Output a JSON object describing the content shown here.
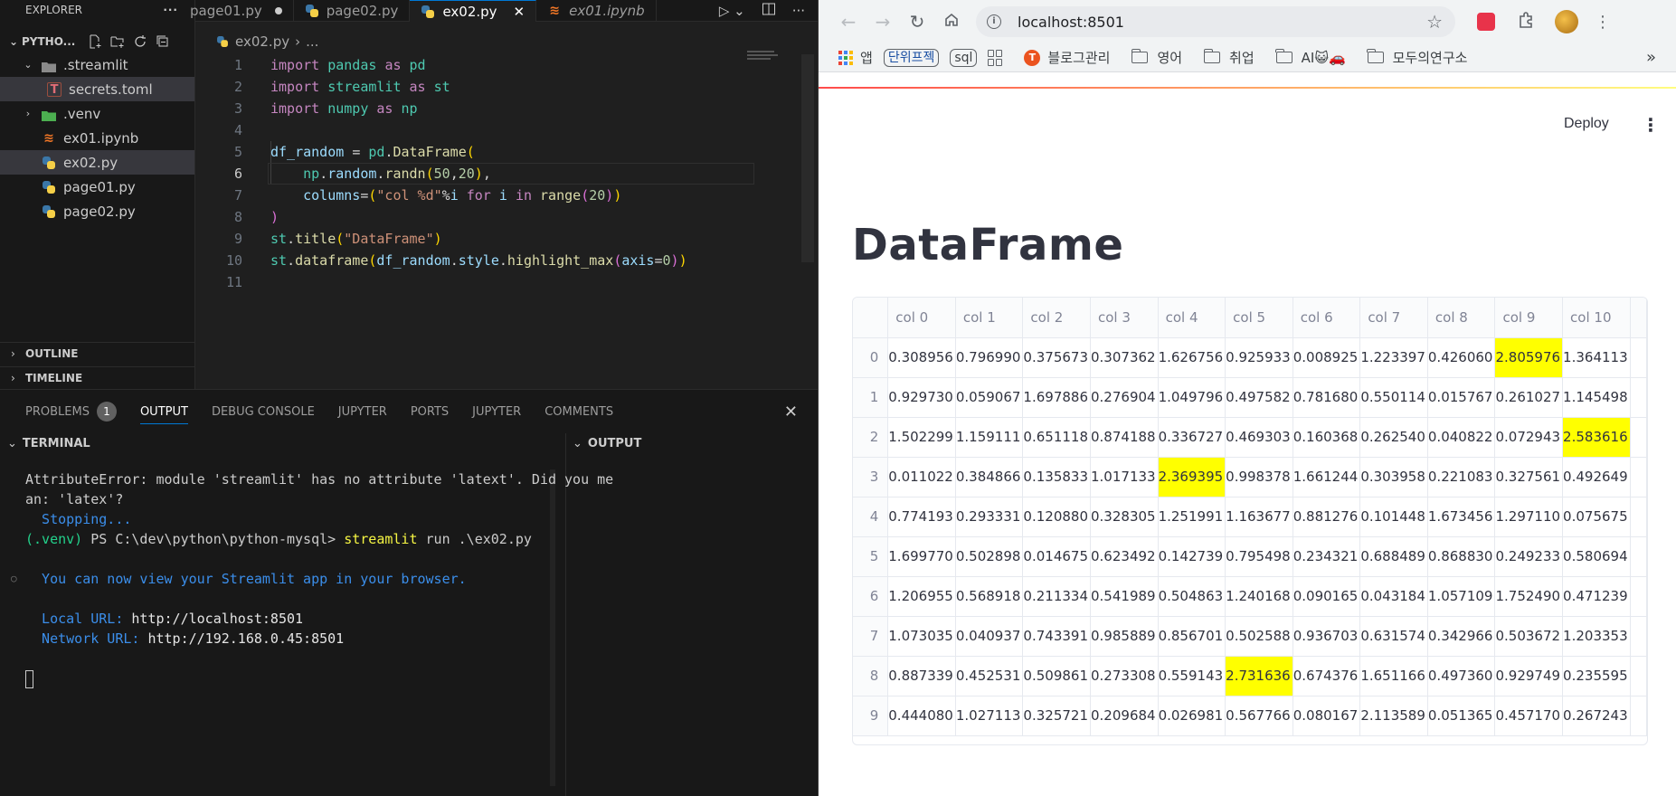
{
  "explorer": {
    "header": "EXPLORER",
    "more": "···",
    "root": "PYTHO...",
    "items": [
      {
        "label": ".streamlit"
      },
      {
        "label": "secrets.toml"
      },
      {
        "label": ".venv"
      },
      {
        "label": "ex01.ipynb"
      },
      {
        "label": "ex02.py"
      },
      {
        "label": "page01.py"
      },
      {
        "label": "page02.py"
      }
    ],
    "outline": "OUTLINE",
    "timeline": "TIMELINE"
  },
  "tabs": [
    {
      "label": "page01.py"
    },
    {
      "label": "page02.py"
    },
    {
      "label": "ex02.py"
    },
    {
      "label": "ex01.ipynb"
    }
  ],
  "breadcrumb": {
    "file": "ex02.py",
    "rest": "..."
  },
  "code_lines": [
    "import pandas as pd",
    "import streamlit as st",
    "import numpy as np",
    "",
    "df_random = pd.DataFrame(",
    "    np.random.randn(50,20),",
    "    columns=(\"col %d\"%i for i in range(20))",
    ")",
    "st.title(\"DataFrame\")",
    "st.dataframe(df_random.style.highlight_max(axis=0))",
    ""
  ],
  "panel": {
    "tabs": [
      "PROBLEMS",
      "OUTPUT",
      "DEBUG CONSOLE",
      "JUPYTER",
      "PORTS",
      "JUPYTER",
      "COMMENTS"
    ],
    "problems_count": "1",
    "terminal_header": "TERMINAL",
    "output_header": "OUTPUT"
  },
  "terminal": {
    "error_1": "AttributeError: module 'streamlit' has no attribute 'latext'. Did you me",
    "error_2": "an: 'latex'?",
    "stopping": "  Stopping...",
    "venv": "(.venv)",
    "prompt": " PS C:\\dev\\python\\python-mysql> ",
    "cmd": "streamlit",
    "cmd_args": " run .\\ex02.py",
    "view_msg": "  You can now view your Streamlit app in your browser.",
    "local_label": "  Local URL: ",
    "local_url": "http://localhost:8501",
    "network_label": "  Network URL: ",
    "network_url": "http://192.168.0.45:8501"
  },
  "browser": {
    "url": "localhost:8501",
    "bookmarks": {
      "apps": "앱",
      "unit_project": "단위프젝",
      "sql": "sql",
      "blog": "블로그관리",
      "english": "영어",
      "job": "취업",
      "ai": "AI😺🚗",
      "modu": "모두의연구소"
    }
  },
  "app": {
    "deploy": "Deploy",
    "title": "DataFrame"
  },
  "dataframe": {
    "columns": [
      "col 0",
      "col 1",
      "col 2",
      "col 3",
      "col 4",
      "col 5",
      "col 6",
      "col 7",
      "col 8",
      "col 9",
      "col 10"
    ],
    "rows": [
      {
        "index": "0",
        "cells": [
          "0.308956",
          "0.796990",
          "0.375673",
          "0.307362",
          "1.626756",
          "0.925933",
          "0.008925",
          "1.223397",
          "0.426060",
          "2.805976",
          "1.364113"
        ],
        "highlight": [
          9
        ]
      },
      {
        "index": "1",
        "cells": [
          "0.929730",
          "0.059067",
          "1.697886",
          "0.276904",
          "1.049796",
          "0.497582",
          "0.781680",
          "0.550114",
          "0.015767",
          "0.261027",
          "1.145498"
        ],
        "highlight": []
      },
      {
        "index": "2",
        "cells": [
          "1.502299",
          "1.159111",
          "0.651118",
          "0.874188",
          "0.336727",
          "0.469303",
          "0.160368",
          "0.262540",
          "0.040822",
          "0.072943",
          "2.583616"
        ],
        "highlight": [
          10
        ]
      },
      {
        "index": "3",
        "cells": [
          "0.011022",
          "0.384866",
          "0.135833",
          "1.017133",
          "2.369395",
          "0.998378",
          "1.661244",
          "0.303958",
          "0.221083",
          "0.327561",
          "0.492649"
        ],
        "highlight": [
          4
        ]
      },
      {
        "index": "4",
        "cells": [
          "0.774193",
          "0.293331",
          "0.120880",
          "0.328305",
          "1.251991",
          "1.163677",
          "0.881276",
          "0.101448",
          "1.673456",
          "1.297110",
          "0.075675"
        ],
        "highlight": []
      },
      {
        "index": "5",
        "cells": [
          "1.699770",
          "0.502898",
          "0.014675",
          "0.623492",
          "0.142739",
          "0.795498",
          "0.234321",
          "0.688489",
          "0.868830",
          "0.249233",
          "0.580694"
        ],
        "highlight": []
      },
      {
        "index": "6",
        "cells": [
          "1.206955",
          "0.568918",
          "0.211334",
          "0.541989",
          "0.504863",
          "1.240168",
          "0.090165",
          "0.043184",
          "1.057109",
          "1.752490",
          "0.471239"
        ],
        "highlight": []
      },
      {
        "index": "7",
        "cells": [
          "1.073035",
          "0.040937",
          "0.743391",
          "0.985889",
          "0.856701",
          "0.502588",
          "0.936703",
          "0.631574",
          "0.342966",
          "0.503672",
          "1.203353"
        ],
        "highlight": []
      },
      {
        "index": "8",
        "cells": [
          "0.887339",
          "0.452531",
          "0.509861",
          "0.273308",
          "0.559143",
          "2.731636",
          "0.674376",
          "1.651166",
          "0.497360",
          "0.929749",
          "0.235595"
        ],
        "highlight": [
          5
        ]
      },
      {
        "index": "9",
        "cells": [
          "0.444080",
          "1.027113",
          "0.325721",
          "0.209684",
          "0.026981",
          "0.567766",
          "0.080167",
          "2.113589",
          "0.051365",
          "0.457170",
          "0.267243"
        ],
        "highlight": []
      }
    ],
    "highlight_color": "#ffff00"
  }
}
